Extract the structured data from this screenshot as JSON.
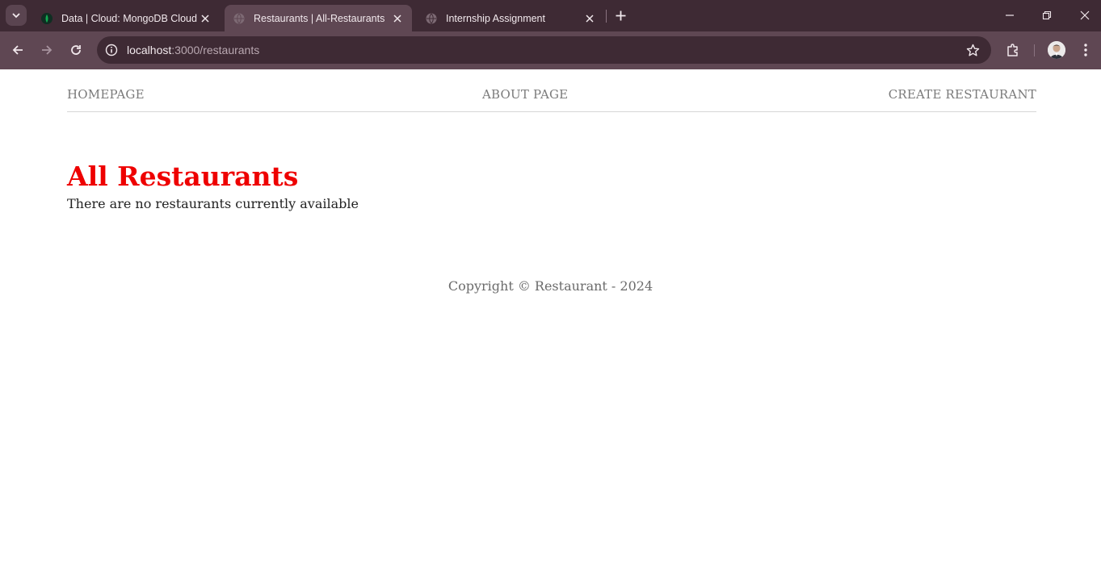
{
  "browser": {
    "tabs": [
      {
        "title": "Data | Cloud: MongoDB Cloud",
        "active": false,
        "favicon": "mongodb-leaf-icon"
      },
      {
        "title": "Restaurants | All-Restaurants",
        "active": true,
        "favicon": "globe-icon"
      },
      {
        "title": "Internship Assignment",
        "active": false,
        "favicon": "globe-icon"
      }
    ],
    "address": {
      "host": "localhost",
      "path": ":3000/restaurants"
    },
    "colors": {
      "frame": "#3e2a34",
      "toolbar": "#5f4753",
      "text": "#f2e9ed"
    }
  },
  "site": {
    "nav": {
      "home": "HOMEPAGE",
      "about": "ABOUT PAGE",
      "create": "CREATE RESTAURANT"
    },
    "heading": "All Restaurants",
    "empty_message": "There are no restaurants currently available",
    "footer": "Copyright © Restaurant - 2024",
    "colors": {
      "heading": "#ee0000",
      "nav": "#7a7a7a"
    }
  }
}
